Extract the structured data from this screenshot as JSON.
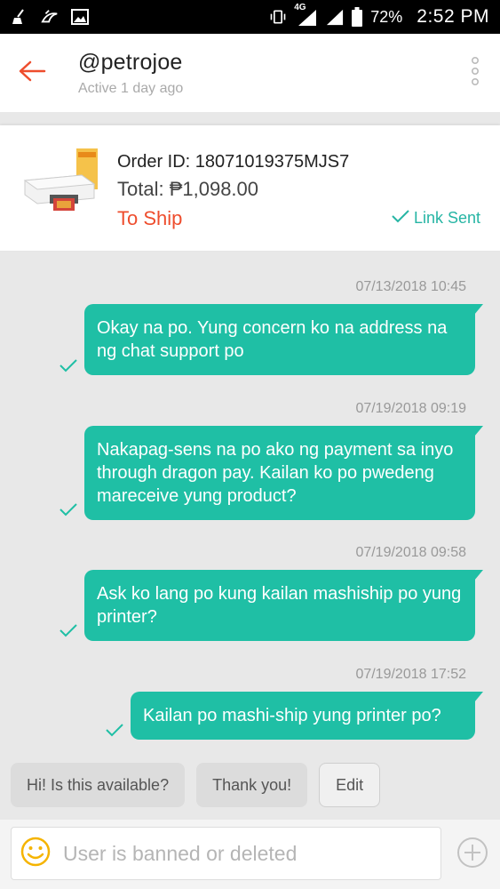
{
  "status_bar": {
    "network": "4G",
    "battery": "72%",
    "time": "2:52 PM",
    "icons": [
      "broom-icon",
      "bird-icon",
      "image-icon",
      "vibrate-icon",
      "signal-icon",
      "signal-icon",
      "battery-icon"
    ]
  },
  "header": {
    "title": "@petrojoe",
    "subtitle": "Active 1 day ago",
    "icons": [
      "back-arrow-icon",
      "more-vertical-icon"
    ]
  },
  "order": {
    "id_text": "Order ID: 18071019375MJS7",
    "total_text": "Total: ₱1,098.00",
    "status": "To Ship",
    "link_status": "Link Sent",
    "thumb": "printer-product-image"
  },
  "messages": [
    {
      "time": "07/13/2018 10:45",
      "text": "Okay na po. Yung concern ko na address na ng chat support po"
    },
    {
      "time": "07/19/2018 09:19",
      "text": "Nakapag-sens na po ako ng payment sa inyo through dragon pay. Kailan ko po pwedeng mareceive yung product?"
    },
    {
      "time": "07/19/2018 09:58",
      "text": "Ask ko lang po kung kailan mashiship po yung printer?"
    },
    {
      "time": "07/19/2018 17:52",
      "text": "Kailan po mashi-ship yung printer po?"
    }
  ],
  "quick_replies": [
    "Hi! Is this available?",
    "Thank you!",
    "Edit"
  ],
  "input": {
    "placeholder": "User is banned or deleted",
    "icons": [
      "emoji-icon",
      "plus-circle-icon"
    ]
  },
  "colors": {
    "accent_orange": "#ee4d2d",
    "bubble_teal": "#1fbfa5",
    "link_teal": "#26b5a4"
  }
}
